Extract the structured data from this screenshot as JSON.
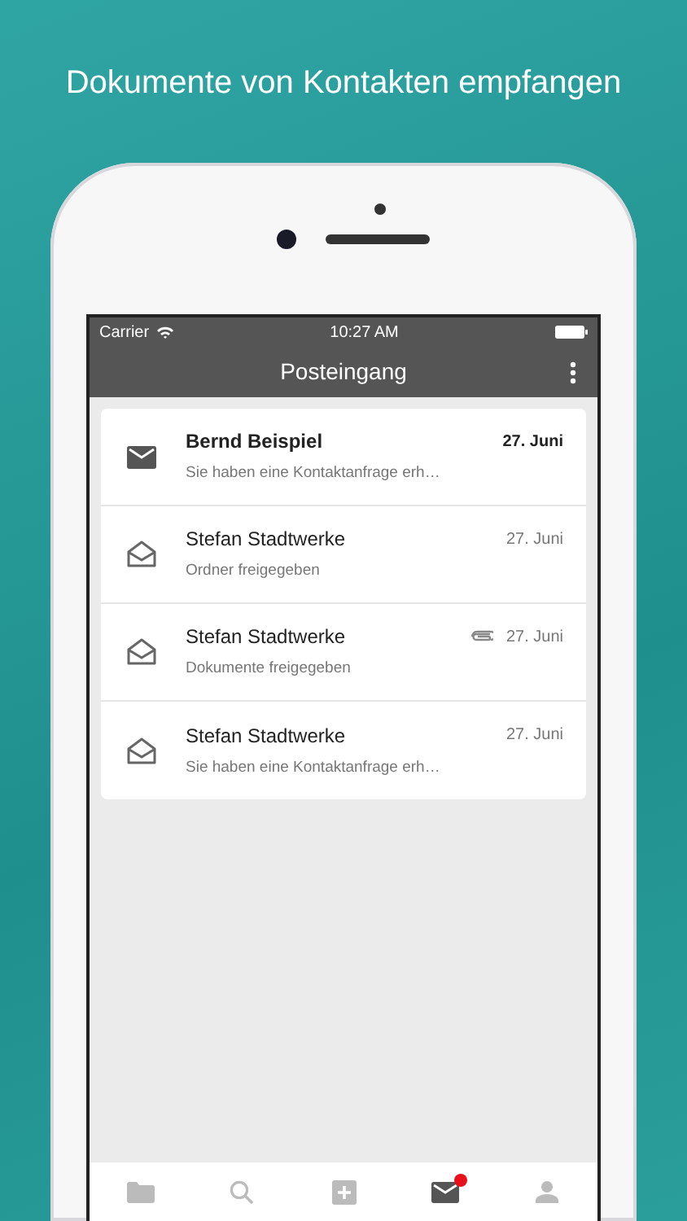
{
  "headline": "Dokumente von Kontakten empfangen",
  "status_bar": {
    "carrier": "Carrier",
    "time": "10:27 AM"
  },
  "nav_bar": {
    "title": "Posteingang"
  },
  "messages": [
    {
      "sender": "Bernd Beispiel",
      "preview": "Sie haben eine Kontaktanfrage erh…",
      "date": "27. Juni",
      "unread": true,
      "attachment": false
    },
    {
      "sender": "Stefan Stadtwerke",
      "preview": "Ordner freigegeben",
      "date": "27. Juni",
      "unread": false,
      "attachment": false
    },
    {
      "sender": "Stefan Stadtwerke",
      "preview": "Dokumente freigegeben",
      "date": "27. Juni",
      "unread": false,
      "attachment": true
    },
    {
      "sender": "Stefan Stadtwerke",
      "preview": "Sie haben eine Kontaktanfrage erh…",
      "date": "27. Juni",
      "unread": false,
      "attachment": false
    }
  ],
  "tab_bar": [
    {
      "kind": "folder",
      "selected": false,
      "badge": false
    },
    {
      "kind": "search",
      "selected": false,
      "badge": false
    },
    {
      "kind": "add",
      "selected": false,
      "badge": false
    },
    {
      "kind": "mail",
      "selected": true,
      "badge": true
    },
    {
      "kind": "profile",
      "selected": false,
      "badge": false
    }
  ]
}
